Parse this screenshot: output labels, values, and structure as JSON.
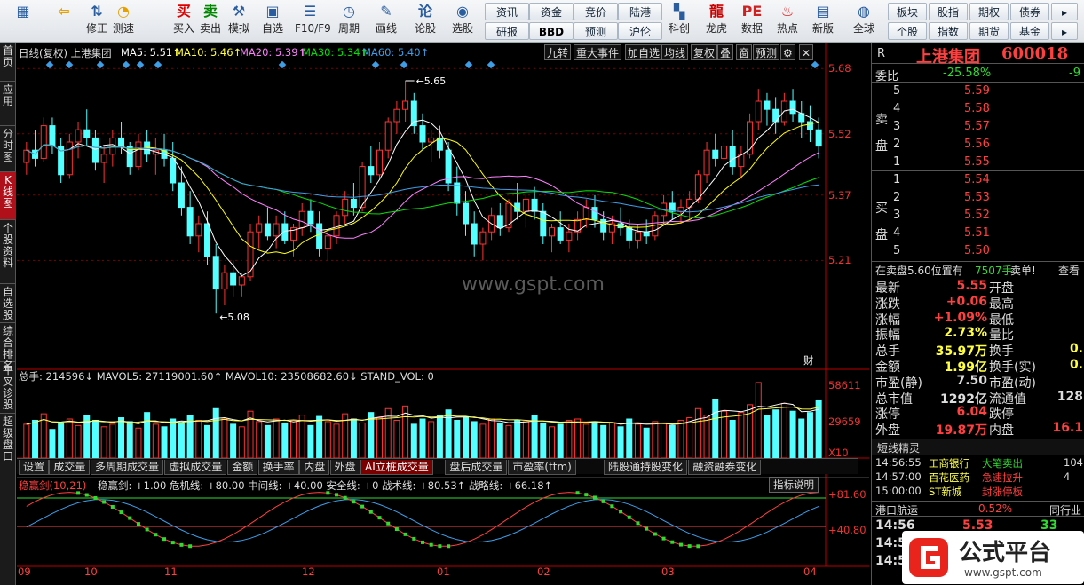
{
  "toolbar": {
    "big": [
      {
        "label": "",
        "icon": "windows-grid-icon"
      },
      {
        "label": "",
        "icon": "back-arrow-icon"
      },
      {
        "label": "修正",
        "icon": "up-down-icon"
      },
      {
        "label": "测速",
        "icon": "clock-icon"
      },
      {
        "label": "买入",
        "icon": "buy-icon",
        "glyph": "买"
      },
      {
        "label": "卖出",
        "icon": "sell-icon",
        "glyph": "卖"
      },
      {
        "label": "模拟",
        "icon": "hammer-icon"
      },
      {
        "label": "自选",
        "icon": "folder-icon"
      },
      {
        "label": "F10/F9",
        "icon": "f10-icon"
      },
      {
        "label": "周期",
        "icon": "period-icon"
      },
      {
        "label": "画线",
        "icon": "pen-icon"
      },
      {
        "label": "论股",
        "icon": "discuss-icon"
      },
      {
        "label": "选股",
        "icon": "search-chart-icon"
      },
      {
        "label": "科创",
        "icon": "tech-icon"
      },
      {
        "label": "龙虎",
        "icon": "dragon-icon"
      },
      {
        "label": "数据",
        "icon": "pe-icon",
        "glyph": "PE"
      },
      {
        "label": "热点",
        "icon": "hot-icon"
      },
      {
        "label": "新版",
        "icon": "new-icon"
      },
      {
        "label": "全球",
        "icon": "globe-icon"
      }
    ],
    "small_row1": [
      "资讯",
      "资金",
      "竞价",
      "陆港"
    ],
    "small_row2": [
      "研报",
      "BBD",
      "预测",
      "沪伦"
    ],
    "right_row1": [
      "板块",
      "股指",
      "期权",
      "债券"
    ],
    "right_row2": [
      "个股",
      "指数",
      "期货",
      "基金"
    ]
  },
  "leftbar": [
    "首页",
    "应用",
    "分时图",
    "K线图",
    "个股资料",
    "自选股",
    "综合排名",
    "牛叉诊股",
    "超级盘口"
  ],
  "header": {
    "title": "日线(复权) 上港集团",
    "ma5": "MA5: 5.51↑",
    "ma10": "MA10: 5.46↑",
    "ma20": "MA20: 5.39↑",
    "ma30": "MA30: 5.34↑",
    "ma60": "MA60: 5.40↑",
    "chips": [
      "九转",
      "重大事件",
      "加自选",
      "均线",
      "复权",
      "叠",
      "窗",
      "预测"
    ]
  },
  "price_axis": [
    "5.68",
    "5.52",
    "5.37",
    "5.21"
  ],
  "annotations": {
    "high": "5.65",
    "low": "5.08",
    "cai": "财"
  },
  "volume": {
    "header": "总手: 214596↓ MAVOL5: 27119001.60↑ MAVOL10: 23508682.60↓ STAND_VOL: 0",
    "axis": [
      "58611",
      "29659",
      "X10"
    ]
  },
  "tabs": [
    "设置",
    "成交量",
    "多周期成交量",
    "虚拟成交量",
    "金额",
    "换手率",
    "内盘",
    "外盘",
    "AI立桩成交量",
    "盘后成交量",
    "市盈率(ttm)",
    "陆股通持股变化",
    "融资融券变化"
  ],
  "indicator": {
    "header_name": "稳赢剑(10,21)",
    "header_rest": "稳赢剑: +1.00  危机线: +80.00  中间线: +40.00  安全线: +0  战术线: +80.53↑  战略线: +66.18↑",
    "button": "指标说明",
    "axis": [
      "+81.60",
      "+40.80"
    ]
  },
  "x_axis": [
    "09",
    "10",
    "11",
    "12",
    "01",
    "02",
    "03",
    "04"
  ],
  "watermark": "www.gspt.com",
  "quote": {
    "r": "R",
    "name": "上港集团",
    "code": "600018",
    "weibi_label": "委比",
    "weibi": "-25.58%",
    "weibi_right": "-9",
    "sell_label": "卖盘",
    "buy_label": "买盘",
    "sell": [
      {
        "n": "5",
        "p": "5.59"
      },
      {
        "n": "4",
        "p": "5.58"
      },
      {
        "n": "3",
        "p": "5.57"
      },
      {
        "n": "2",
        "p": "5.56"
      },
      {
        "n": "1",
        "p": "5.55"
      }
    ],
    "buy": [
      {
        "n": "1",
        "p": "5.54"
      },
      {
        "n": "2",
        "p": "5.53"
      },
      {
        "n": "3",
        "p": "5.52"
      },
      {
        "n": "4",
        "p": "5.51"
      },
      {
        "n": "5",
        "p": "5.50"
      }
    ],
    "notice": "在卖盘5.60位置有",
    "notice_vol": "7507手",
    "notice_act": "卖单!",
    "notice_btn": "查看",
    "stats": [
      {
        "l": "最新",
        "v": "5.55",
        "l2": "开盘",
        "c": "red"
      },
      {
        "l": "涨跌",
        "v": "+0.06",
        "l2": "最高",
        "c": "red"
      },
      {
        "l": "涨幅",
        "v": "+1.09%",
        "l2": "最低",
        "c": "red"
      },
      {
        "l": "振幅",
        "v": "2.73%",
        "l2": "量比",
        "c": "yel"
      },
      {
        "l": "总手",
        "v": "35.97万",
        "l2": "换手",
        "v2": "0.",
        "c": "yel"
      },
      {
        "l": "金额",
        "v": "1.99亿",
        "l2": "换手(实)",
        "v2": "0.",
        "c": "yel"
      },
      {
        "l": "市盈(静)",
        "v": "7.50",
        "l2": "市盈(动)",
        "c": "wh"
      },
      {
        "l": "总市值",
        "v": "1292亿",
        "l2": "流通值",
        "v2": "128",
        "c": "wh"
      },
      {
        "l": "涨停",
        "v": "6.04",
        "l2": "跌停",
        "c": "red"
      },
      {
        "l": "外盘",
        "v": "19.87万",
        "l2": "内盘",
        "v2": "16.1",
        "c": "red"
      }
    ],
    "sprite_title": "短线精灵",
    "sprites": [
      {
        "t": "14:56:55",
        "s": "工商银行",
        "e": "大笔卖出",
        "v": "104"
      },
      {
        "t": "14:57:00",
        "s": "百花医药",
        "e": "急速拉升",
        "v": "4"
      },
      {
        "t": "15:00:00",
        "s": "ST新城",
        "e": "封涨停板",
        "v": ""
      }
    ],
    "related_name": "港口航运",
    "related_pct": "0.52%",
    "related_btn": "同行业",
    "ticks": [
      {
        "t": "14:56",
        "p": "5.53",
        "v": "33"
      },
      {
        "t": "14:5",
        "p": "",
        "v": ""
      },
      {
        "t": "14:5",
        "p": "",
        "v": ""
      }
    ]
  },
  "logo": {
    "text": "公式平台",
    "url": "www.gspt.com"
  },
  "colors": {
    "up": "#ff3232",
    "down": "#54ffff",
    "ma5": "#ffffff",
    "ma10": "#ffff00",
    "ma20": "#ff80ff",
    "ma30": "#00e000",
    "ma60": "#3d9ee8"
  },
  "chart_data": {
    "type": "candlestick",
    "ohlc": [
      [
        5.45,
        5.5,
        5.42,
        5.48
      ],
      [
        5.48,
        5.53,
        5.44,
        5.46
      ],
      [
        5.46,
        5.56,
        5.45,
        5.54
      ],
      [
        5.54,
        5.56,
        5.47,
        5.49
      ],
      [
        5.49,
        5.51,
        5.4,
        5.42
      ],
      [
        5.42,
        5.52,
        5.41,
        5.5
      ],
      [
        5.5,
        5.55,
        5.46,
        5.53
      ],
      [
        5.53,
        5.58,
        5.49,
        5.51
      ],
      [
        5.51,
        5.53,
        5.43,
        5.45
      ],
      [
        5.45,
        5.49,
        5.4,
        5.47
      ],
      [
        5.47,
        5.53,
        5.44,
        5.51
      ],
      [
        5.51,
        5.55,
        5.47,
        5.49
      ],
      [
        5.49,
        5.5,
        5.42,
        5.44
      ],
      [
        5.44,
        5.52,
        5.43,
        5.5
      ],
      [
        5.5,
        5.53,
        5.45,
        5.47
      ],
      [
        5.47,
        5.51,
        5.42,
        5.48
      ],
      [
        5.48,
        5.52,
        5.44,
        5.46
      ],
      [
        5.46,
        5.5,
        5.38,
        5.4
      ],
      [
        5.4,
        5.44,
        5.32,
        5.34
      ],
      [
        5.34,
        5.38,
        5.25,
        5.27
      ],
      [
        5.27,
        5.32,
        5.23,
        5.3
      ],
      [
        5.3,
        5.33,
        5.2,
        5.22
      ],
      [
        5.22,
        5.25,
        5.08,
        5.14
      ],
      [
        5.14,
        5.2,
        5.1,
        5.18
      ],
      [
        5.18,
        5.21,
        5.12,
        5.15
      ],
      [
        5.15,
        5.18,
        5.12,
        5.17
      ],
      [
        5.17,
        5.3,
        5.16,
        5.28
      ],
      [
        5.28,
        5.32,
        5.24,
        5.3
      ],
      [
        5.3,
        5.34,
        5.26,
        5.27
      ],
      [
        5.27,
        5.32,
        5.24,
        5.3
      ],
      [
        5.3,
        5.33,
        5.25,
        5.26
      ],
      [
        5.26,
        5.3,
        5.22,
        5.29
      ],
      [
        5.29,
        5.35,
        5.27,
        5.33
      ],
      [
        5.33,
        5.36,
        5.28,
        5.3
      ],
      [
        5.3,
        5.33,
        5.22,
        5.24
      ],
      [
        5.24,
        5.28,
        5.21,
        5.27
      ],
      [
        5.27,
        5.33,
        5.25,
        5.32
      ],
      [
        5.32,
        5.38,
        5.3,
        5.36
      ],
      [
        5.36,
        5.4,
        5.32,
        5.34
      ],
      [
        5.34,
        5.45,
        5.33,
        5.44
      ],
      [
        5.44,
        5.49,
        5.4,
        5.42
      ],
      [
        5.42,
        5.5,
        5.41,
        5.48
      ],
      [
        5.48,
        5.56,
        5.46,
        5.55
      ],
      [
        5.55,
        5.6,
        5.52,
        5.58
      ],
      [
        5.58,
        5.65,
        5.55,
        5.6
      ],
      [
        5.6,
        5.62,
        5.52,
        5.54
      ],
      [
        5.54,
        5.57,
        5.48,
        5.5
      ],
      [
        5.5,
        5.53,
        5.45,
        5.51
      ],
      [
        5.51,
        5.54,
        5.46,
        5.48
      ],
      [
        5.48,
        5.5,
        5.38,
        5.4
      ],
      [
        5.4,
        5.44,
        5.32,
        5.35
      ],
      [
        5.35,
        5.38,
        5.27,
        5.3
      ],
      [
        5.3,
        5.33,
        5.22,
        5.25
      ],
      [
        5.25,
        5.29,
        5.21,
        5.28
      ],
      [
        5.28,
        5.34,
        5.26,
        5.32
      ],
      [
        5.32,
        5.35,
        5.27,
        5.29
      ],
      [
        5.29,
        5.36,
        5.28,
        5.35
      ],
      [
        5.35,
        5.4,
        5.31,
        5.33
      ],
      [
        5.33,
        5.37,
        5.29,
        5.36
      ],
      [
        5.36,
        5.39,
        5.31,
        5.33
      ],
      [
        5.33,
        5.35,
        5.25,
        5.27
      ],
      [
        5.27,
        5.3,
        5.23,
        5.29
      ],
      [
        5.29,
        5.33,
        5.25,
        5.26
      ],
      [
        5.26,
        5.3,
        5.23,
        5.28
      ],
      [
        5.28,
        5.33,
        5.26,
        5.31
      ],
      [
        5.31,
        5.36,
        5.29,
        5.34
      ],
      [
        5.34,
        5.37,
        5.29,
        5.31
      ],
      [
        5.31,
        5.33,
        5.26,
        5.28
      ],
      [
        5.28,
        5.32,
        5.25,
        5.3
      ],
      [
        5.3,
        5.34,
        5.27,
        5.29
      ],
      [
        5.29,
        5.31,
        5.24,
        5.26
      ],
      [
        5.26,
        5.3,
        5.24,
        5.28
      ],
      [
        5.28,
        5.31,
        5.25,
        5.27
      ],
      [
        5.27,
        5.33,
        5.26,
        5.32
      ],
      [
        5.32,
        5.37,
        5.3,
        5.35
      ],
      [
        5.35,
        5.38,
        5.31,
        5.33
      ],
      [
        5.33,
        5.36,
        5.3,
        5.34
      ],
      [
        5.34,
        5.38,
        5.31,
        5.36
      ],
      [
        5.36,
        5.43,
        5.35,
        5.42
      ],
      [
        5.42,
        5.5,
        5.4,
        5.48
      ],
      [
        5.48,
        5.52,
        5.44,
        5.46
      ],
      [
        5.46,
        5.5,
        5.42,
        5.49
      ],
      [
        5.49,
        5.53,
        5.42,
        5.44
      ],
      [
        5.44,
        5.49,
        5.41,
        5.47
      ],
      [
        5.47,
        5.57,
        5.46,
        5.55
      ],
      [
        5.55,
        5.63,
        5.53,
        5.6
      ],
      [
        5.6,
        5.62,
        5.54,
        5.58
      ],
      [
        5.58,
        5.61,
        5.52,
        5.55
      ],
      [
        5.55,
        5.62,
        5.54,
        5.6
      ],
      [
        5.6,
        5.63,
        5.55,
        5.57
      ],
      [
        5.57,
        5.6,
        5.51,
        5.55
      ],
      [
        5.55,
        5.59,
        5.5,
        5.53
      ],
      [
        5.53,
        5.56,
        5.46,
        5.49
      ]
    ],
    "volumes": [
      26,
      29,
      34,
      22,
      27,
      30,
      25,
      33,
      29,
      24,
      26,
      31,
      28,
      23,
      35,
      26,
      24,
      30,
      27,
      33,
      29,
      25,
      38,
      30,
      26,
      24,
      36,
      28,
      25,
      30,
      27,
      29,
      33,
      25,
      32,
      28,
      26,
      34,
      30,
      27,
      35,
      31,
      38,
      29,
      40,
      26,
      30,
      28,
      33,
      37,
      29,
      31,
      28,
      26,
      30,
      27,
      25,
      29,
      28,
      33,
      27,
      24,
      26,
      29,
      30,
      26,
      28,
      25,
      27,
      24,
      30,
      26,
      23,
      28,
      27,
      25,
      29,
      31,
      38,
      33,
      45,
      36,
      29,
      35,
      41,
      58,
      33,
      37,
      42,
      36,
      30,
      35,
      44
    ],
    "ylim": [
      5.08,
      5.68
    ],
    "x": [
      "09",
      "10",
      "11",
      "12",
      "01",
      "02",
      "03",
      "04"
    ]
  }
}
